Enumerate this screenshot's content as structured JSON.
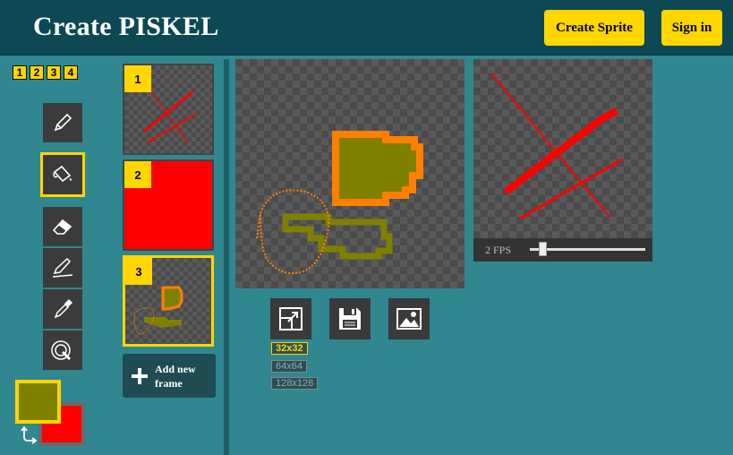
{
  "header": {
    "title": "Create PISKEL",
    "create_sprite_label": "Create Sprite",
    "sign_in_label": "Sign in"
  },
  "layers": [
    "1",
    "2",
    "3",
    "4"
  ],
  "tools": [
    {
      "name": "pen-icon",
      "selected": false
    },
    {
      "name": "paint-bucket-icon",
      "selected": true
    },
    {
      "name": "eraser-icon",
      "selected": false
    },
    {
      "name": "stroke-icon",
      "selected": false
    },
    {
      "name": "eyedropper-icon",
      "selected": false
    },
    {
      "name": "lighten-icon",
      "selected": false
    }
  ],
  "frames": [
    {
      "number": "1",
      "selected": false
    },
    {
      "number": "2",
      "selected": false
    },
    {
      "number": "3",
      "selected": true
    }
  ],
  "add_frame_label": "Add new frame",
  "fps": {
    "label": "2 FPS",
    "value": 2
  },
  "sizes": [
    {
      "label": "32x32",
      "selected": true
    },
    {
      "label": "64x64",
      "selected": false
    },
    {
      "label": "128x128",
      "selected": false
    }
  ],
  "colors": {
    "primary": "#808000",
    "secondary": "#ff0000",
    "accent": "#ffd600",
    "header_bg": "#0d4854",
    "page_bg": "#30878f"
  }
}
